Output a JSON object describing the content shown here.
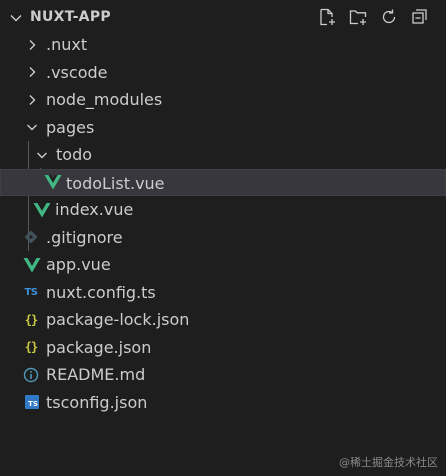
{
  "explorer": {
    "title": "NUXT-APP",
    "actions": [
      {
        "name": "new-file",
        "icon": "new-file-icon"
      },
      {
        "name": "new-folder",
        "icon": "new-folder-icon"
      },
      {
        "name": "refresh",
        "icon": "refresh-icon"
      },
      {
        "name": "collapse-all",
        "icon": "collapse-all-icon"
      }
    ]
  },
  "tree": {
    "items": [
      {
        "label": ".nuxt",
        "type": "folder",
        "expanded": false,
        "depth": 0
      },
      {
        "label": ".vscode",
        "type": "folder",
        "expanded": false,
        "depth": 0
      },
      {
        "label": "node_modules",
        "type": "folder",
        "expanded": false,
        "depth": 0
      },
      {
        "label": "pages",
        "type": "folder",
        "expanded": true,
        "depth": 0
      },
      {
        "label": "todo",
        "type": "folder",
        "expanded": true,
        "depth": 1
      },
      {
        "label": "todoList.vue",
        "type": "vue",
        "depth": 2,
        "selected": true
      },
      {
        "label": "index.vue",
        "type": "vue",
        "depth": 1
      },
      {
        "label": ".gitignore",
        "type": "git",
        "depth": 0
      },
      {
        "label": "app.vue",
        "type": "vue",
        "depth": 0
      },
      {
        "label": "nuxt.config.ts",
        "type": "ts",
        "depth": 0
      },
      {
        "label": "package-lock.json",
        "type": "json",
        "depth": 0
      },
      {
        "label": "package.json",
        "type": "json",
        "depth": 0
      },
      {
        "label": "README.md",
        "type": "info",
        "depth": 0
      },
      {
        "label": "tsconfig.json",
        "type": "tsconfig",
        "depth": 0
      }
    ]
  },
  "icon_text": {
    "ts": "TS",
    "json": "{}",
    "tsconfig": "TS"
  },
  "watermark": "@稀土掘金技术社区",
  "colors": {
    "background": "#1e1e1e",
    "text": "#cccccc",
    "selected_row": "#37373d",
    "vue_green": "#41b883",
    "ts_blue": "#3d8fd6",
    "json_yellow": "#cbcb41",
    "info_blue": "#519aba",
    "git_gray": "#41535b"
  }
}
